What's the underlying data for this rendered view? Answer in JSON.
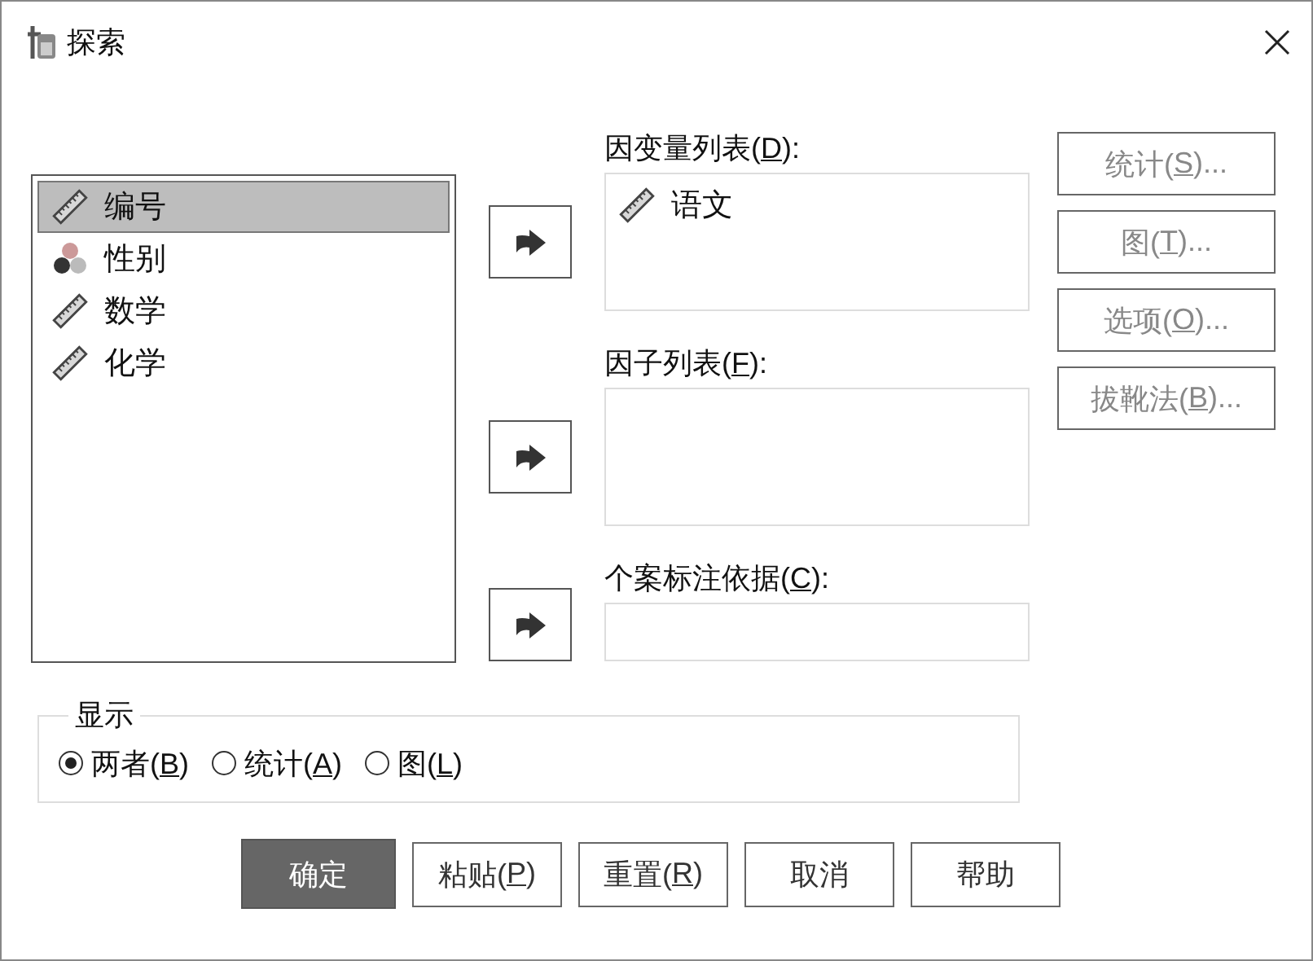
{
  "window": {
    "title": "探索"
  },
  "variables": [
    {
      "name": "编号",
      "kind": "scale",
      "selected": true
    },
    {
      "name": "性别",
      "kind": "nominal",
      "selected": false
    },
    {
      "name": "数学",
      "kind": "scale",
      "selected": false
    },
    {
      "name": "化学",
      "kind": "scale",
      "selected": false
    }
  ],
  "target_lists": [
    {
      "label": [
        "因变量列表(",
        "D",
        "):"
      ],
      "kind": "list",
      "items": [
        {
          "name": "语文",
          "kind": "scale"
        }
      ]
    },
    {
      "label": [
        "因子列表(",
        "F",
        "):"
      ],
      "kind": "list"
    },
    {
      "label": [
        "个案标注依据(",
        "C",
        "):"
      ],
      "kind": "field"
    }
  ],
  "side_buttons": [
    {
      "label": [
        "统计(",
        "S",
        ")..."
      ],
      "disabled": true
    },
    {
      "label": [
        "图(",
        "T",
        ")..."
      ],
      "disabled": true
    },
    {
      "label": [
        "选项(",
        "O",
        ")..."
      ],
      "disabled": true
    },
    {
      "label": [
        "拔靴法(",
        "B",
        ")..."
      ],
      "disabled": true
    }
  ],
  "display": {
    "title": "显示",
    "options": [
      {
        "label": [
          "两者(",
          "B",
          ")"
        ],
        "selected": true
      },
      {
        "label": [
          "统计(",
          "A",
          ")"
        ],
        "selected": false
      },
      {
        "label": [
          "图(",
          "L",
          ")"
        ],
        "selected": false
      }
    ]
  },
  "buttons": [
    {
      "label": [
        "确定"
      ],
      "default": true
    },
    {
      "label": [
        "粘贴(",
        "P",
        ")"
      ],
      "default": false
    },
    {
      "label": [
        "重置(",
        "R",
        ")"
      ],
      "default": false
    },
    {
      "label": [
        "取消"
      ],
      "default": false
    },
    {
      "label": [
        "帮助"
      ],
      "default": false
    }
  ]
}
